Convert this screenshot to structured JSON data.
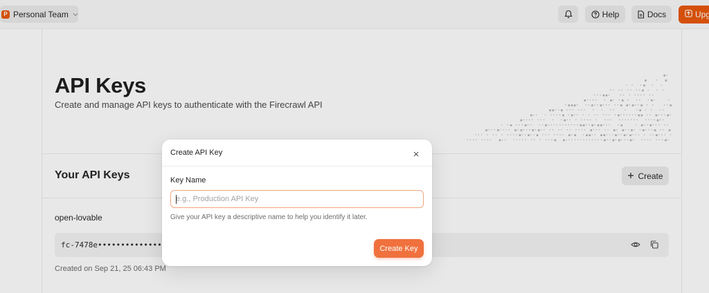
{
  "topbar": {
    "team_badge": "P",
    "team_name": "Personal Team",
    "help_label": "Help",
    "docs_label": "Docs",
    "upgrade_label": "Upgrade"
  },
  "page": {
    "title": "API Keys",
    "subtitle": "Create and manage API keys to authenticate with the Firecrawl API"
  },
  "keys_section": {
    "title": "Your API Keys",
    "create_label": "Create",
    "keys": [
      {
        "name": "open-lovable",
        "masked_key": "fc-7478e••••••••••••••••",
        "created": "Created on  Sep 21, 25 06:43 PM"
      }
    ]
  },
  "modal": {
    "title": "Create API Key",
    "field_label": "Key Name",
    "input_value": "",
    "input_placeholder": "e.g., Production API Key",
    "help_text": "Give your API key a descriptive name to help you identify it later.",
    "submit_label": "Create Key"
  },
  "colors": {
    "brand": "#ea580c",
    "submit": "#f0713d",
    "input_border": "#f2a57e"
  },
  "icons": [
    "bell-icon",
    "help-circle-icon",
    "document-icon",
    "upgrade-arrow-icon",
    "plus-icon",
    "eye-icon",
    "copy-icon",
    "close-icon",
    "chevron-down-icon"
  ]
}
